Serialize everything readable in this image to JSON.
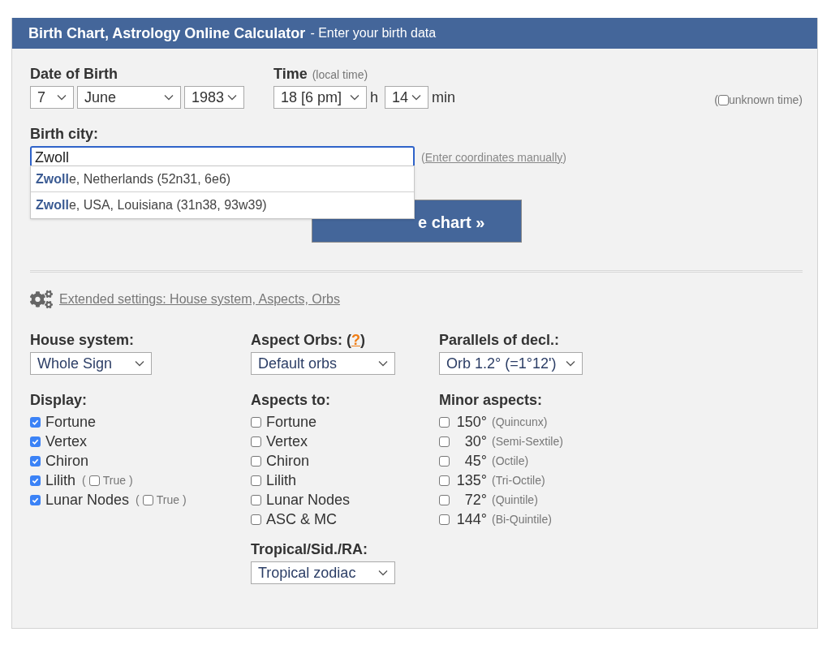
{
  "header": {
    "title": "Birth Chart, Astrology Online Calculator",
    "subtitle": "- Enter your birth data"
  },
  "date_of_birth": {
    "label": "Date of Birth",
    "day": "7",
    "month": "June",
    "year": "1983"
  },
  "time": {
    "label": "Time",
    "hint": "(local time)",
    "hour": "18 [6 pm]",
    "hour_unit": "h",
    "minute": "14",
    "minute_unit": "min"
  },
  "unknown_time": {
    "open": "(",
    "checked": false,
    "label": "unknown time)"
  },
  "birth_city": {
    "label": "Birth city:",
    "value": "Zwoll",
    "manual_open": "(",
    "manual_link": "Enter coordinates manually",
    "manual_close": ")"
  },
  "suggestions": [
    {
      "text": "**Zwoll**e, Netherlands (52n31, 6e6)"
    },
    {
      "text": "**Zwoll**e, USA, Louisiana (31n38, 93w39)"
    }
  ],
  "calculate_button": "e chart »",
  "extended_settings_link": "Extended settings: House system, Aspects, Orbs",
  "house_system": {
    "label": "House system:",
    "value": "Whole Sign"
  },
  "aspect_orbs": {
    "label": "Aspect Orbs:",
    "open": "(",
    "help": "?",
    "close": ")",
    "value": "Default orbs"
  },
  "parallels": {
    "label": "Parallels of decl.:",
    "value": "Orb 1.2° (=1°12')"
  },
  "display": {
    "label": "Display:",
    "items": [
      {
        "label": "Fortune",
        "checked": true
      },
      {
        "label": "Vertex",
        "checked": true
      },
      {
        "label": "Chiron",
        "checked": true
      },
      {
        "label": "Lilith",
        "checked": true,
        "option": {
          "open": "(",
          "checked": false,
          "label": "True",
          "close": ")"
        }
      },
      {
        "label": "Lunar Nodes",
        "checked": true,
        "option": {
          "open": "(",
          "checked": false,
          "label": "True",
          "close": ")"
        }
      }
    ]
  },
  "aspects_to": {
    "label": "Aspects to:",
    "items": [
      {
        "label": "Fortune",
        "checked": false
      },
      {
        "label": "Vertex",
        "checked": false
      },
      {
        "label": "Chiron",
        "checked": false
      },
      {
        "label": "Lilith",
        "checked": false
      },
      {
        "label": "Lunar Nodes",
        "checked": false
      },
      {
        "label": "ASC & MC",
        "checked": false
      }
    ]
  },
  "minor_aspects": {
    "label": "Minor aspects:",
    "items": [
      {
        "degree": "150°",
        "name": "(Quincunx)",
        "checked": false
      },
      {
        "degree": "30°",
        "name": "(Semi-Sextile)",
        "checked": false
      },
      {
        "degree": "45°",
        "name": "(Octile)",
        "checked": false
      },
      {
        "degree": "135°",
        "name": "(Tri-Octile)",
        "checked": false
      },
      {
        "degree": "72°",
        "name": "(Quintile)",
        "checked": false
      },
      {
        "degree": "144°",
        "name": "(Bi-Quintile)",
        "checked": false
      }
    ]
  },
  "zodiac": {
    "label": "Tropical/Sid./RA:",
    "value": "Tropical zodiac"
  }
}
